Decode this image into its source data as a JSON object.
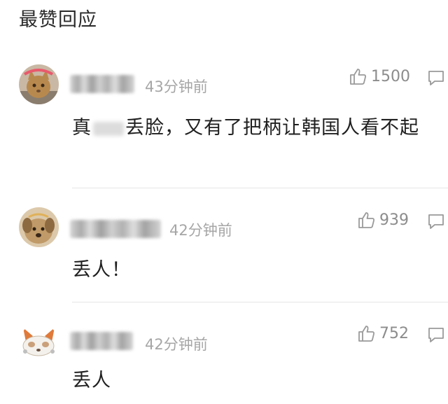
{
  "section_title": "最赞回应",
  "comments": [
    {
      "time": "43分钟前",
      "likes": "1500",
      "text_prefix": "真",
      "text_rest": "丢脸，又有了把柄让韩国人看不起",
      "avatar_icon": "cat-avatar-icon"
    },
    {
      "time": "42分钟前",
      "likes": "939",
      "text": "丢人！",
      "avatar_icon": "dog-avatar-icon"
    },
    {
      "time": "42分钟前",
      "likes": "752",
      "text": "丢人",
      "avatar_icon": "fox-avatar-icon"
    }
  ],
  "colors": {
    "meta_gray": "#a6a6a6",
    "icon_gray": "#9a9a9a",
    "divider": "#e6e6e6"
  }
}
